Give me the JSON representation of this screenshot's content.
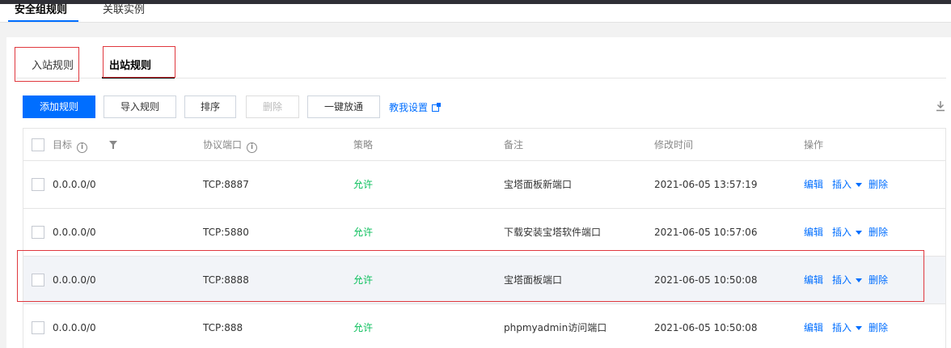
{
  "top_tabs": [
    {
      "label": "安全组规则"
    },
    {
      "label": "关联实例"
    }
  ],
  "sub_tabs": [
    {
      "label": "入站规则"
    },
    {
      "label": "出站规则"
    }
  ],
  "toolbar": {
    "add_rule": "添加规则",
    "import_rule": "导入规则",
    "sort": "排序",
    "delete": "删除",
    "one_click_open": "一键放通",
    "help_link": "教我设置"
  },
  "table": {
    "headers": {
      "target": "目标",
      "protocol_port": "协议端口",
      "policy": "策略",
      "remark": "备注",
      "modified_time": "修改时间",
      "actions": "操作"
    },
    "rows": [
      {
        "target": "0.0.0.0/0",
        "port": "TCP:8887",
        "policy": "允许",
        "remark": "宝塔面板新端口",
        "time": "2021-06-05 13:57:19"
      },
      {
        "target": "0.0.0.0/0",
        "port": "TCP:5880",
        "policy": "允许",
        "remark": "下载安装宝塔软件端口",
        "time": "2021-06-05 10:57:06"
      },
      {
        "target": "0.0.0.0/0",
        "port": "TCP:8888",
        "policy": "允许",
        "remark": "宝塔面板端口",
        "time": "2021-06-05 10:50:08"
      },
      {
        "target": "0.0.0.0/0",
        "port": "TCP:888",
        "policy": "允许",
        "remark": "phpmyadmin访问端口",
        "time": "2021-06-05 10:50:08"
      }
    ],
    "row_actions": {
      "edit": "编辑",
      "insert": "插入",
      "delete": "删除"
    }
  },
  "colors": {
    "accent": "#006eff",
    "allow": "#0abf5b",
    "highlight_box": "#e0383e"
  }
}
